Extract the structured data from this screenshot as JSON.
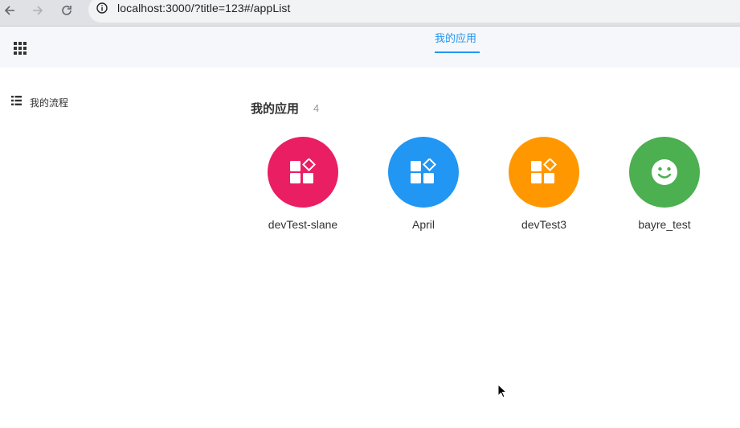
{
  "browser": {
    "url": "localhost:3000/?title=123#/appList"
  },
  "header": {
    "tab_label": "我的应用"
  },
  "sidebar": {
    "items": [
      {
        "label": "我的流程",
        "icon": "list-icon"
      }
    ]
  },
  "main": {
    "section_title": "我的应用",
    "section_count": "4",
    "apps": [
      {
        "name": "devTest-slane",
        "color": "#e91e63",
        "icon": "apps-icon"
      },
      {
        "name": "April",
        "color": "#2196f3",
        "icon": "apps-icon"
      },
      {
        "name": "devTest3",
        "color": "#ff9800",
        "icon": "apps-icon"
      },
      {
        "name": "bayre_test",
        "color": "#4caf50",
        "icon": "smiley-icon"
      }
    ]
  },
  "colors": {
    "accent": "#2196f3",
    "header_bg": "#f5f7fa"
  }
}
